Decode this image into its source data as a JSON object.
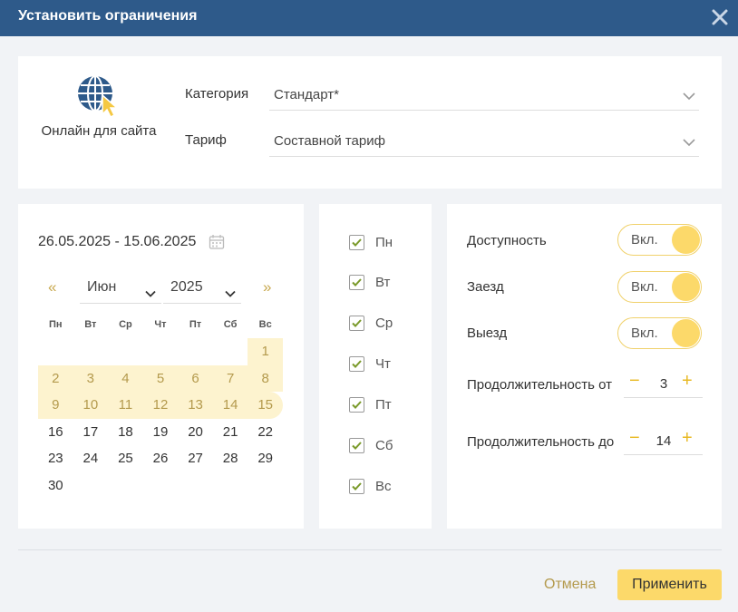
{
  "dialog": {
    "title": "Установить ограничения",
    "close_icon": "close-icon"
  },
  "channel": {
    "label": "Онлайн для сайта",
    "icon": "globe-cursor-icon"
  },
  "fields": {
    "category": {
      "label": "Категория",
      "value": "Стандарт*"
    },
    "tariff": {
      "label": "Тариф",
      "value": "Составной тариф"
    }
  },
  "calendar": {
    "range": "26.05.2025 - 15.06.2025",
    "prev": "«",
    "next": "»",
    "month": "Июн",
    "year": "2025",
    "weekdays": [
      "Пн",
      "Вт",
      "Ср",
      "Чт",
      "Пт",
      "Сб",
      "Вс"
    ],
    "first_weekday_index": 6,
    "days_in_month": 30,
    "selected_until": 15
  },
  "days": [
    {
      "label": "Пн",
      "checked": true
    },
    {
      "label": "Вт",
      "checked": true
    },
    {
      "label": "Ср",
      "checked": true
    },
    {
      "label": "Чт",
      "checked": true
    },
    {
      "label": "Пт",
      "checked": true
    },
    {
      "label": "Сб",
      "checked": true
    },
    {
      "label": "Вс",
      "checked": true
    }
  ],
  "options": {
    "availability": {
      "label": "Доступность",
      "state": "Вкл."
    },
    "arrival": {
      "label": "Заезд",
      "state": "Вкл."
    },
    "departure": {
      "label": "Выезд",
      "state": "Вкл."
    },
    "min_stay": {
      "label": "Продолжительность от",
      "value": "3",
      "minus": "−",
      "plus": "+"
    },
    "max_stay": {
      "label": "Продолжительность до",
      "value": "14",
      "minus": "−",
      "plus": "+"
    }
  },
  "footer": {
    "cancel": "Отмена",
    "apply": "Применить"
  },
  "colors": {
    "header": "#2e5a8a",
    "accent": "#fcd96a",
    "selected_range": "#fdf3cf",
    "check": "#7a9a2a"
  }
}
